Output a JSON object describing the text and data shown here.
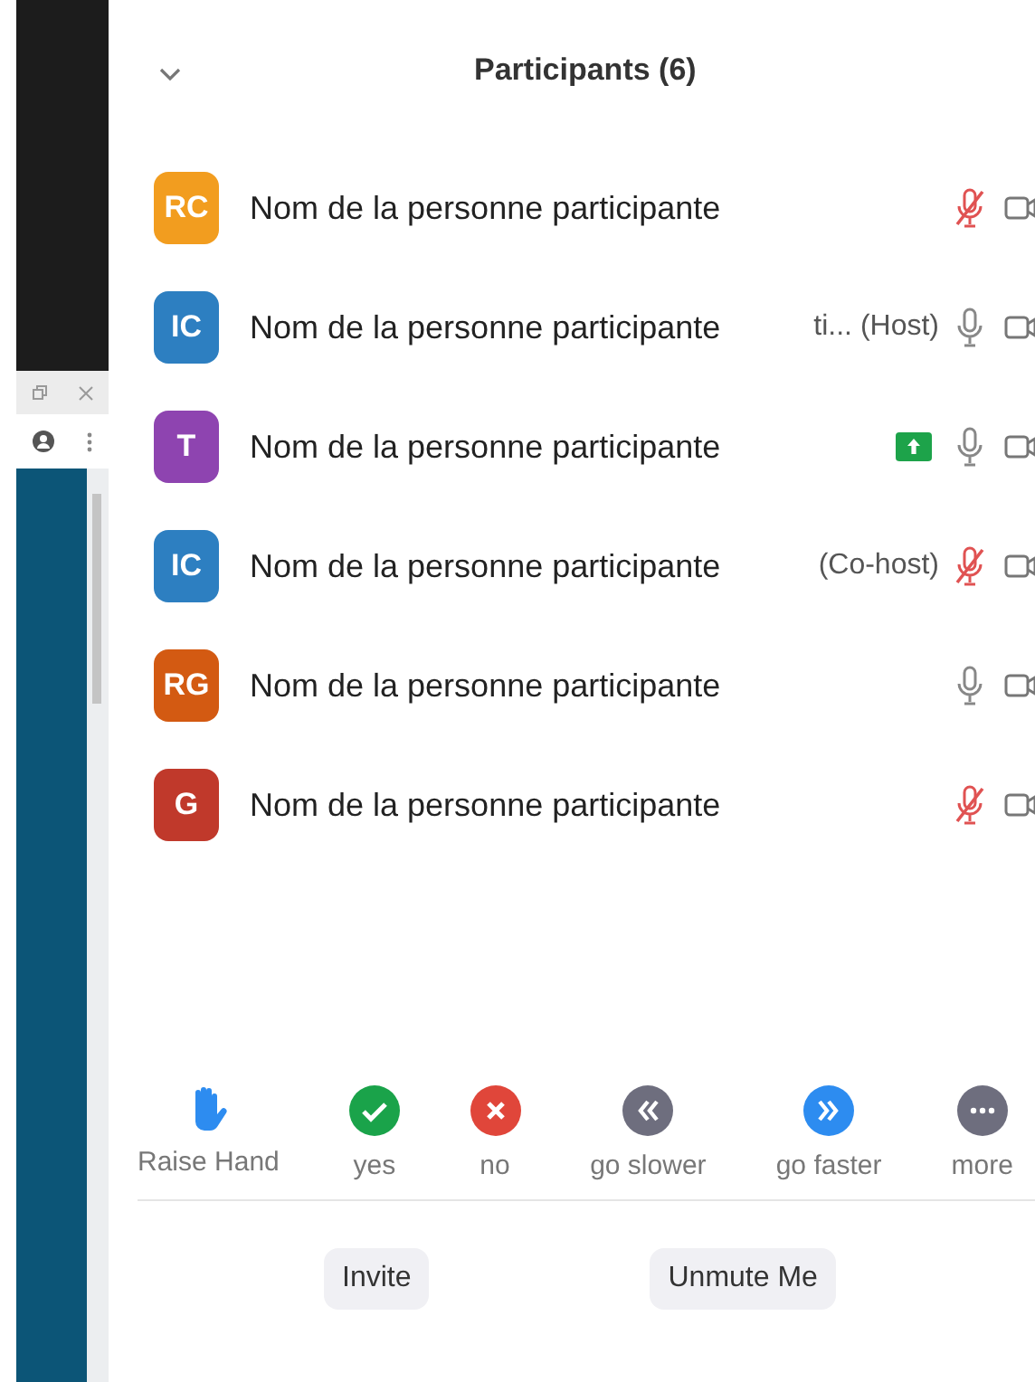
{
  "title": "Participants (6)",
  "participants": [
    {
      "initials": "RC",
      "color": "#f29d1f",
      "name": "Nom de la personne participante",
      "sharing": false,
      "muted": true
    },
    {
      "initials": "IC",
      "color": "#2d7fc1",
      "name": "Nom de la personne participante",
      "role": "ti... (Host)",
      "sharing": false,
      "muted": false
    },
    {
      "initials": "T",
      "color": "#8e44b0",
      "name": "Nom de la personne participante",
      "sharing": true,
      "muted": false
    },
    {
      "initials": "IC",
      "color": "#2d7fc1",
      "name": "Nom de la personne participante",
      "role": "(Co-host)",
      "sharing": false,
      "muted": true
    },
    {
      "initials": "RG",
      "color": "#d35a12",
      "name": "Nom de la personne participante",
      "sharing": false,
      "muted": false
    },
    {
      "initials": "G",
      "color": "#c0392b",
      "name": "Nom de la personne participante",
      "sharing": false,
      "muted": true
    }
  ],
  "reactions": [
    {
      "kind": "hand",
      "label": "Raise Hand"
    },
    {
      "kind": "yes",
      "label": "yes"
    },
    {
      "kind": "no",
      "label": "no"
    },
    {
      "kind": "slower",
      "label": "go slower"
    },
    {
      "kind": "faster",
      "label": "go faster"
    },
    {
      "kind": "more",
      "label": "more"
    }
  ],
  "buttons": [
    "Invite",
    "Unmute Me"
  ]
}
